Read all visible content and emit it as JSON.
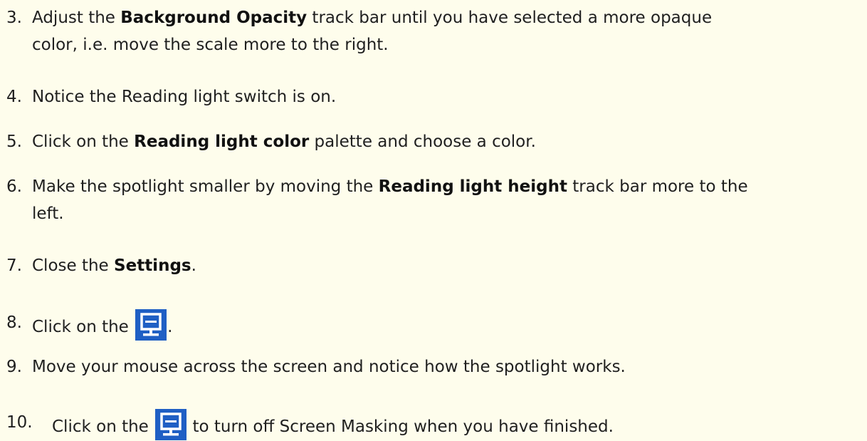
{
  "steps": [
    {
      "number": "3.",
      "line1_pre": "Adjust the ",
      "line1_bold": "Background Opacity",
      "line1_post": " track bar until you have selected a more opaque",
      "line2": "color, i.e. move the scale more to the right."
    },
    {
      "number": "4.",
      "text": "Notice the Reading light switch is on."
    },
    {
      "number": "5.",
      "pre": "Click on the ",
      "bold": "Reading light color",
      "post": " palette and choose a color."
    },
    {
      "number": "6.",
      "line1_pre": "Make the spotlight smaller by moving the ",
      "line1_bold": "Reading light height",
      "line1_post": " track bar more to the",
      "line2": "left."
    },
    {
      "number": "7.",
      "pre": "Close the ",
      "bold": "Settings",
      "post": "."
    },
    {
      "number": "8.",
      "pre": "Click on the ",
      "icon": "screen-masking-icon",
      "post": "."
    },
    {
      "number": "9.",
      "text": "Move your mouse across the screen and notice how the spotlight works."
    },
    {
      "number": "10.",
      "pre": "Click on the ",
      "icon": "screen-masking-icon",
      "post": " to turn off Screen Masking when you have finished."
    }
  ],
  "colors": {
    "background": "#fefdec",
    "text": "#1f1f1f",
    "icon_background": "#1f5fc4",
    "icon_foreground": "#ffffff"
  }
}
